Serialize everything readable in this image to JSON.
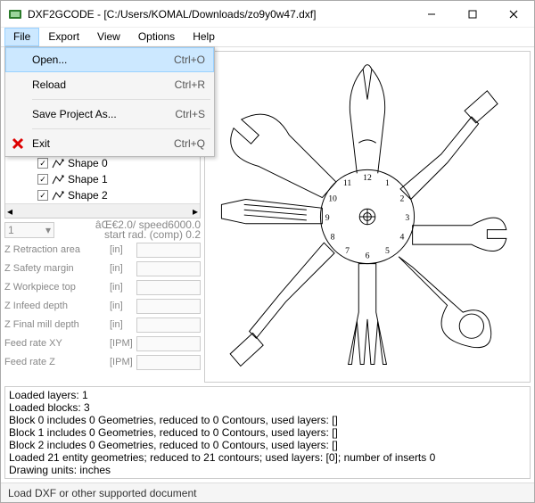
{
  "window": {
    "title": "DXF2GCODE - [C:/Users/KOMAL/Downloads/zo9y0w47.dxf]"
  },
  "menubar": {
    "file": "File",
    "export": "Export",
    "view": "View",
    "options": "Options",
    "help": "Help"
  },
  "file_menu": {
    "open": {
      "label": "Open...",
      "shortcut": "Ctrl+O"
    },
    "reload": {
      "label": "Reload",
      "shortcut": "Ctrl+R"
    },
    "save_as": {
      "label": "Save Project As...",
      "shortcut": "Ctrl+S"
    },
    "exit": {
      "label": "Exit",
      "shortcut": "Ctrl+Q"
    }
  },
  "tree": {
    "shape0": "Shape   0",
    "shape1": "Shape   1",
    "shape2": "Shape   2"
  },
  "params": {
    "select_value": "1",
    "header_line1": "âŒ€2.0/ speed6000.0",
    "header_line2": "start rad. (comp) 0.2",
    "rows": [
      {
        "label": "Z Retraction area",
        "unit": "[in]"
      },
      {
        "label": "Z Safety margin",
        "unit": "[in]"
      },
      {
        "label": "Z Workpiece top",
        "unit": "[in]"
      },
      {
        "label": "Z Infeed depth",
        "unit": "[in]"
      },
      {
        "label": "Z Final mill depth",
        "unit": "[in]"
      },
      {
        "label": "Feed rate XY",
        "unit": "[IPM]"
      },
      {
        "label": "Feed rate Z",
        "unit": "[IPM]"
      }
    ]
  },
  "clock": {
    "n12": "12",
    "n1": "1",
    "n2": "2",
    "n3": "3",
    "n4": "4",
    "n5": "5",
    "n6": "6",
    "n7": "7",
    "n8": "8",
    "n9": "9",
    "n10": "10",
    "n11": "11"
  },
  "log": {
    "l1": "Loaded layers: 1",
    "l2": "Loaded blocks: 3",
    "l3": "Block 0 includes 0 Geometries, reduced to 0 Contours, used layers: []",
    "l4": "Block 1 includes 0 Geometries, reduced to 0 Contours, used layers: []",
    "l5": "Block 2 includes 0 Geometries, reduced to 0 Contours, used layers: []",
    "l6": "Loaded 21 entity geometries; reduced to 21 contours; used layers: [0]; number of inserts 0",
    "l7": "Drawing units: inches"
  },
  "status": {
    "text": "Load DXF or other supported document"
  }
}
